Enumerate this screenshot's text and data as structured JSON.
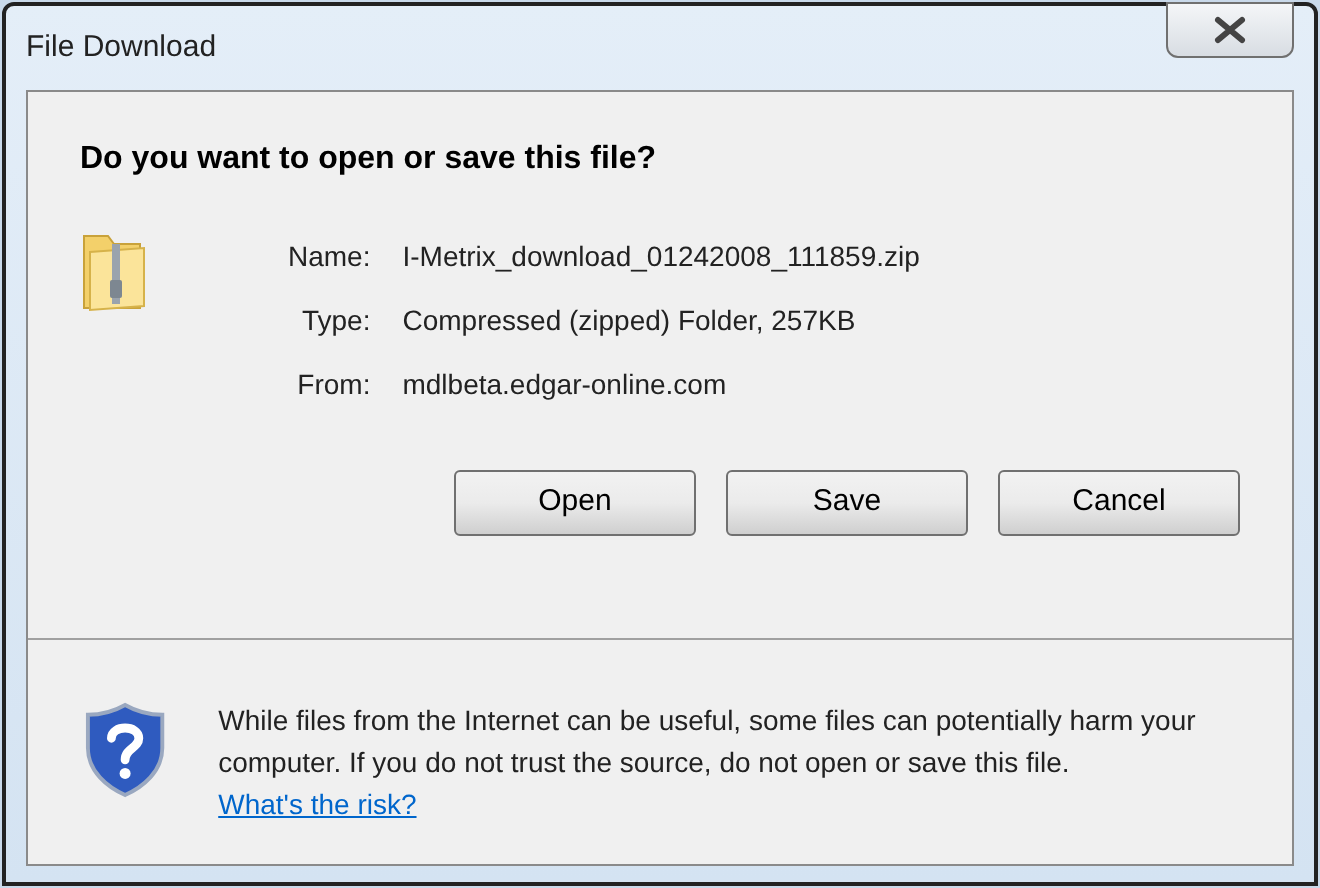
{
  "window": {
    "title": "File Download"
  },
  "question": "Do you want to open or save this file?",
  "file_info": [
    {
      "label": "Name:",
      "value": "I-Metrix_download_01242008_111859.zip"
    },
    {
      "label": "Type:",
      "value": "Compressed (zipped) Folder, 257KB"
    },
    {
      "label": "From:",
      "value": "mdlbeta.edgar-online.com"
    }
  ],
  "buttons": [
    "Open",
    "Save",
    "Cancel"
  ],
  "warning": {
    "text": "While files from the Internet can be useful, some files can potentially harm your computer. If you do not trust the source, do not open or save this file.",
    "link": "What's the risk?"
  }
}
